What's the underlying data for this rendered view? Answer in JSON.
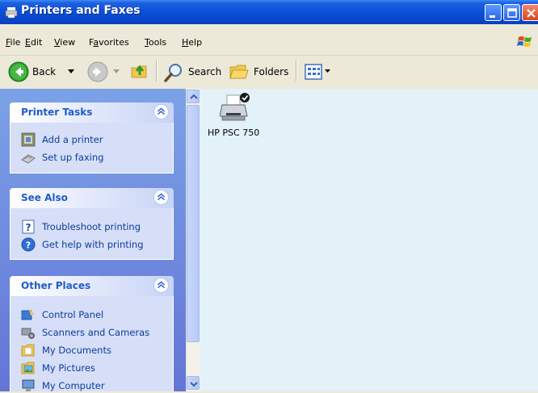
{
  "window": {
    "title": "Printers and Faxes"
  },
  "menu": [
    {
      "label": "File",
      "accel": "F",
      "rest": "ile"
    },
    {
      "label": "Edit",
      "accel": "E",
      "rest": "dit"
    },
    {
      "label": "View",
      "accel": "V",
      "rest": "iew"
    },
    {
      "label": "Favorites",
      "pre": "F",
      "accel": "a",
      "rest": "vorites"
    },
    {
      "label": "Tools",
      "accel": "T",
      "rest": "ools"
    },
    {
      "label": "Help",
      "accel": "H",
      "rest": "elp"
    }
  ],
  "toolbar": {
    "back": "Back",
    "search": "Search",
    "folders": "Folders"
  },
  "panels": {
    "printer_tasks": {
      "title": "Printer Tasks",
      "items": [
        "Add a printer",
        "Set up faxing"
      ]
    },
    "see_also": {
      "title": "See Also",
      "items": [
        "Troubleshoot printing",
        "Get help with printing"
      ]
    },
    "other_places": {
      "title": "Other Places",
      "items": [
        "Control Panel",
        "Scanners and Cameras",
        "My Documents",
        "My Pictures",
        "My Computer"
      ]
    }
  },
  "content": {
    "items": [
      {
        "label": "HP PSC 750",
        "icon": "printer-default-icon"
      }
    ]
  },
  "colors": {
    "titlebar": "#0a4fd8",
    "taskpane": "#6f8ddd",
    "panel_header_text": "#215dc6",
    "task_link": "#0c3b9c",
    "content_bg": "#e3f1f9"
  }
}
